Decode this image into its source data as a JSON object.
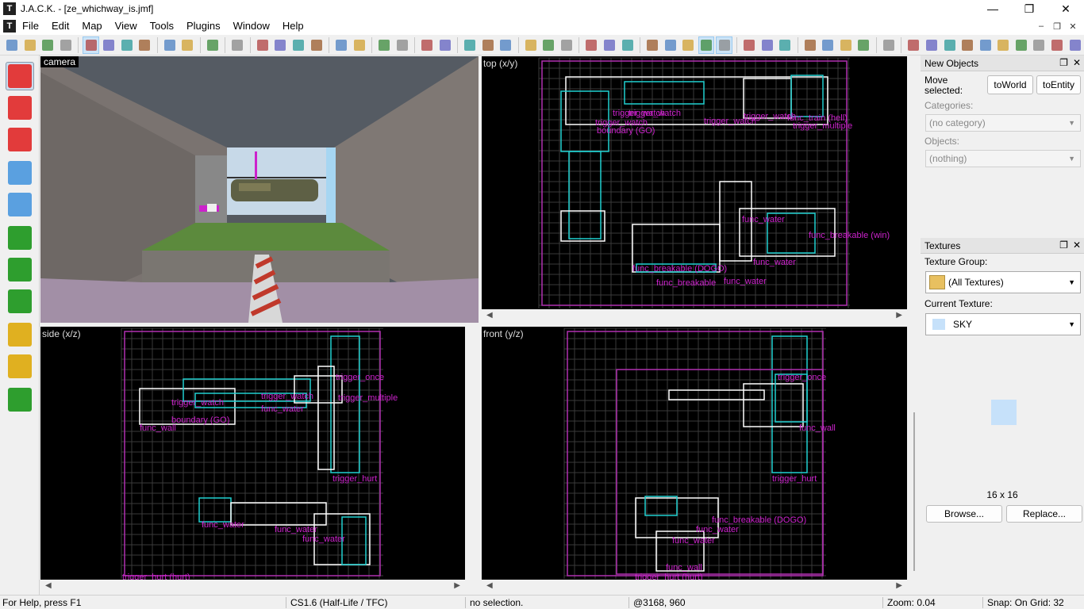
{
  "window": {
    "title": "J.A.C.K. - [ze_whichway_is.jmf]",
    "app_icon": "jack-icon",
    "controls": [
      "minimize-icon",
      "restore-icon",
      "close-icon"
    ]
  },
  "menu": {
    "items": [
      "File",
      "Edit",
      "Map",
      "View",
      "Tools",
      "Plugins",
      "Window",
      "Help"
    ],
    "mdi_controls": [
      "–",
      "❐",
      "✕"
    ]
  },
  "toolbar": {
    "icons": [
      "new-icon",
      "open-icon",
      "save-icon",
      "save-as-icon",
      "sep",
      "grid-icon",
      "3d-grid-icon",
      "grid-smaller-icon",
      "grid-larger-icon",
      "sep",
      "group-icon",
      "ungroup-icon",
      "sep",
      "pointfile-icon",
      "sep",
      "carve-icon",
      "sep",
      "align-left-icon",
      "align-right-icon",
      "align-top-icon",
      "align-bottom-icon",
      "sep",
      "flip-h-icon",
      "flip-v-icon",
      "sep",
      "rotate-left-icon",
      "rotate-right-icon",
      "sep",
      "hide-icon",
      "show-icon",
      "sep",
      "snap-icon",
      "cut-icon",
      "ig-icon",
      "sep",
      "cube-icon",
      "cube-move-icon",
      "cube-rotate-icon",
      "sep",
      "cut2-icon",
      "copy-icon",
      "paste-icon",
      "sep",
      "hatch-icon",
      "select-box-icon",
      "select-all-icon",
      "marquee-icon",
      "3d-view-icon",
      "sep",
      "tl-icon",
      "sl-icon",
      "lock-icon",
      "sep",
      "pen-icon",
      "wrench-icon",
      "red-box-icon",
      "green-box-icon",
      "sep",
      "brush-icon",
      "sep",
      "circle-icon",
      "compass-icon",
      "dots-icon",
      "face-icon",
      "texture-icon",
      "film-icon",
      "nodraw-icon",
      "hint-icon",
      "clip-icon",
      "trig-icon"
    ]
  },
  "left_tools": [
    {
      "name": "selection-tool",
      "icon": "pointer-icon",
      "color": "#e23b3b",
      "active": true
    },
    {
      "name": "magnify-tool",
      "icon": "magnify-icon",
      "color": "#e23b3b"
    },
    {
      "name": "camera-tool",
      "icon": "camera-icon",
      "color": "#e23b3b"
    },
    {
      "name": "entity-tool",
      "icon": "lightbulb-icon",
      "color": "#5aa0e0"
    },
    {
      "name": "block-tool",
      "icon": "block-icon",
      "color": "#5aa0e0"
    },
    {
      "name": "texture-tool",
      "icon": "texture-cube-icon",
      "color": "#2e9e2e"
    },
    {
      "name": "apply-texture-tool",
      "icon": "apply-texture-icon",
      "color": "#2e9e2e"
    },
    {
      "name": "decal-tool",
      "icon": "decal-icon",
      "color": "#2e9e2e"
    },
    {
      "name": "clip-tool",
      "icon": "clip-icon",
      "color": "#e0b020"
    },
    {
      "name": "vertex-tool",
      "icon": "vertex-icon",
      "color": "#e0b020"
    },
    {
      "name": "path-tool",
      "icon": "truck-icon",
      "color": "#2e9e2e"
    }
  ],
  "viewports": {
    "camera": "camera",
    "top": "top (x/y)",
    "side": "side (x/z)",
    "front": "front (y/z)"
  },
  "top_labels": [
    "trigger_watch",
    "trigger_watch",
    "trigger_watch",
    "trigger_watch",
    "trigger_watch",
    "boundary (GO)",
    "func_train (hell)",
    "trigger_multiple",
    "func_water",
    "func_water",
    "func_breakable (win)",
    "func_breakable (DOGO)",
    "func_water",
    "func_breakable"
  ],
  "side_labels": [
    "trigger_once",
    "trigger_watch",
    "trigger_watch",
    "trigger_multiple",
    "func_water",
    "boundary (GO)",
    "func_wall",
    "trigger_hurt",
    "func_water",
    "func_water",
    "func_water",
    "trigger_hurt (hurt)"
  ],
  "front_labels": [
    "trigger_once",
    "func_wall",
    "trigger_hurt",
    "func_breakable (DOGO)",
    "func_water",
    "func_water",
    "func_wall",
    "trigger_hurt (hurt)"
  ],
  "new_objects": {
    "title": "New Objects",
    "move_selected": "Move selected:",
    "to_world": "toWorld",
    "to_entity": "toEntity",
    "categories_label": "Categories:",
    "categories_value": "(no category)",
    "objects_label": "Objects:",
    "objects_value": "(nothing)"
  },
  "textures": {
    "title": "Textures",
    "group_label": "Texture Group:",
    "group_value": "(All Textures)",
    "current_label": "Current Texture:",
    "current_value": "SKY",
    "swatch_color": "#c6e1fa",
    "size": "16 x 16",
    "browse": "Browse...",
    "replace": "Replace..."
  },
  "status": {
    "help": "For Help, press F1",
    "game": "CS1.6 (Half-Life / TFC)",
    "selection": "no selection.",
    "coords": "@3168, 960",
    "zoom": "Zoom: 0.04",
    "snap": "Snap: On Grid: 32"
  },
  "colors": {
    "entity": "#cc22cc",
    "brush_cyan": "#20d0d0",
    "brush_white": "#ffffff",
    "grid": "#3a3a3a",
    "bounds": "#b030b0",
    "link_green": "#20c020"
  }
}
